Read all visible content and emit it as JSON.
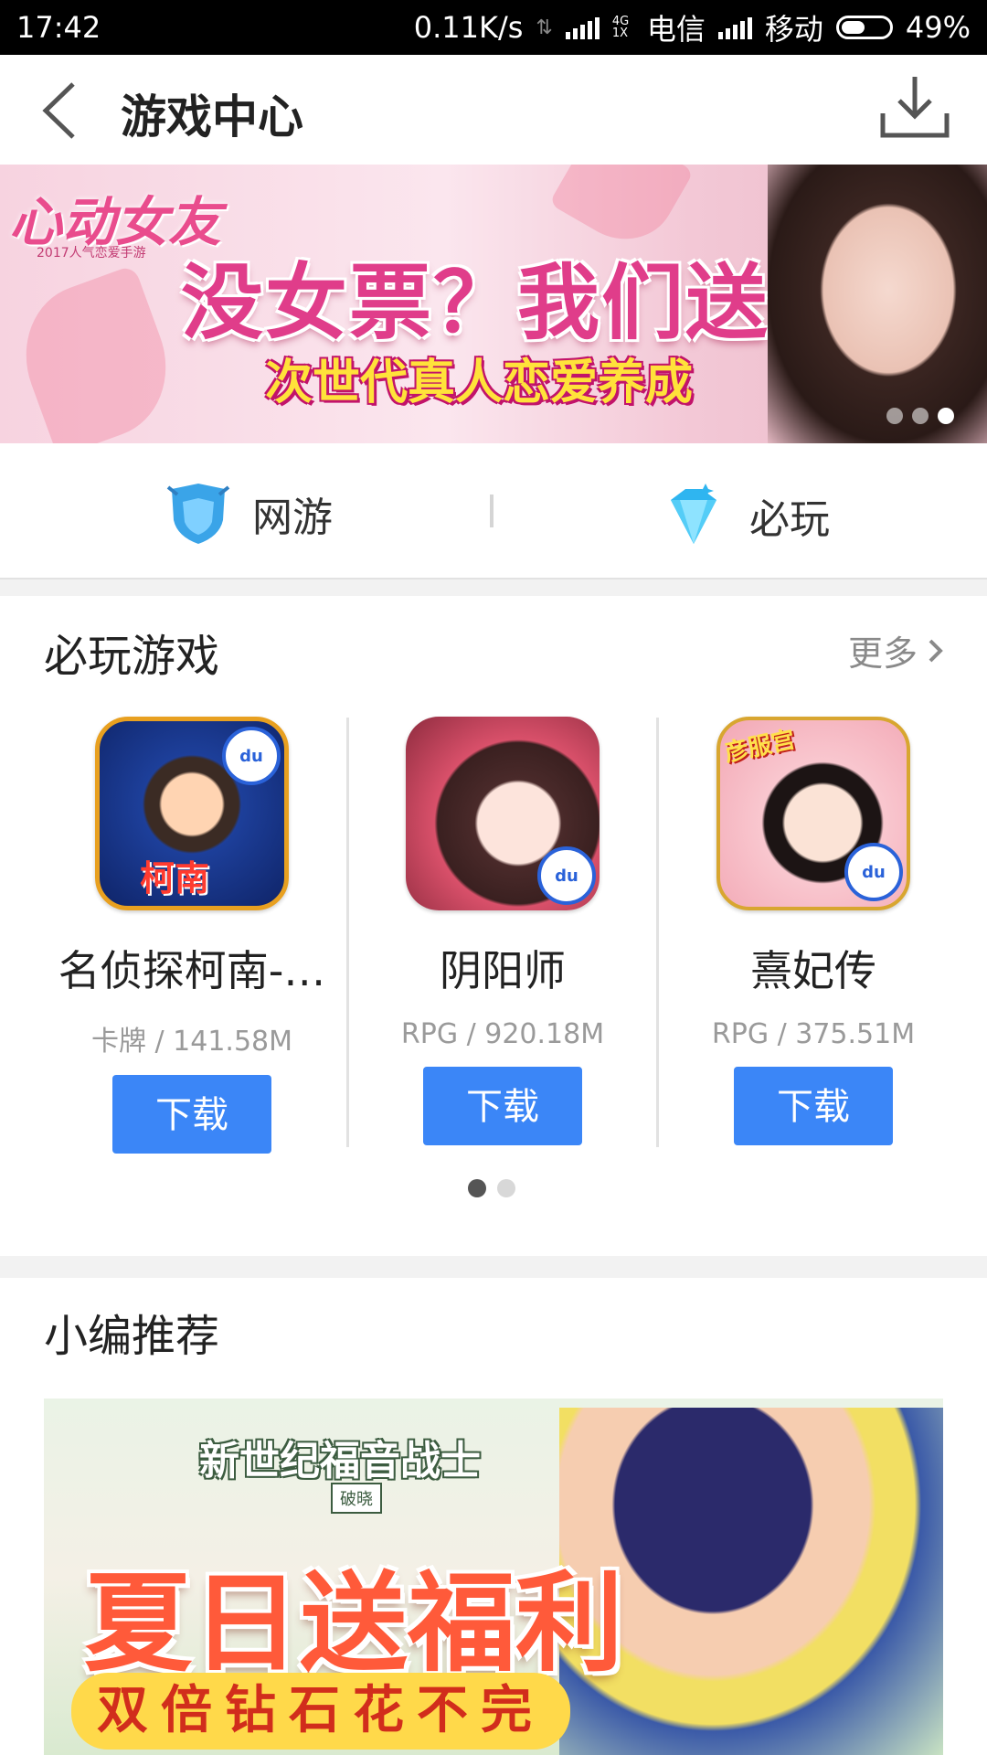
{
  "status_bar": {
    "time": "17:42",
    "net_speed": "0.11K/s",
    "net_type": "4G 1X",
    "carrier1": "电信",
    "carrier2": "移动",
    "battery": "49%",
    "battery_level": 0.49
  },
  "header": {
    "title": "游戏中心",
    "back_icon": "back-arrow-icon",
    "download_icon": "download-icon"
  },
  "banner": {
    "logo": "心动女友",
    "logo_sub": "2017人气恋爱手游",
    "headline": "没女票？我们送你！",
    "subline": "次世代真人恋爱养成",
    "slides": 3,
    "active_slide": 3
  },
  "quicknav": [
    {
      "label": "网游",
      "icon": "shield-icon",
      "color": "#3aa4e8"
    },
    {
      "label": "必玩",
      "icon": "diamond-icon",
      "color": "#2fb5f0"
    }
  ],
  "must_play": {
    "title": "必玩游戏",
    "more": "更多",
    "games": [
      {
        "name": "名侦探柯南-…",
        "meta": "卡牌 / 141.58M",
        "button": "下载",
        "badge": "du",
        "icon_text": "柯南"
      },
      {
        "name": "阴阳师",
        "meta": "RPG / 920.18M",
        "button": "下载",
        "badge": "du"
      },
      {
        "name": "熹妃传",
        "meta": "RPG / 375.51M",
        "button": "下载",
        "badge": "du",
        "icon_text": "彦服宫"
      }
    ],
    "pages": 2,
    "active_page": 1
  },
  "editor_pick": {
    "title": "小编推荐",
    "banner_logo": "新世纪福音战士",
    "banner_logo_sub": "破晓",
    "banner_headline": "夏日送福利",
    "banner_subline": "双倍钻石花不完"
  },
  "colors": {
    "accent": "#3b86f7",
    "brand_pink": "#e03d8a"
  }
}
